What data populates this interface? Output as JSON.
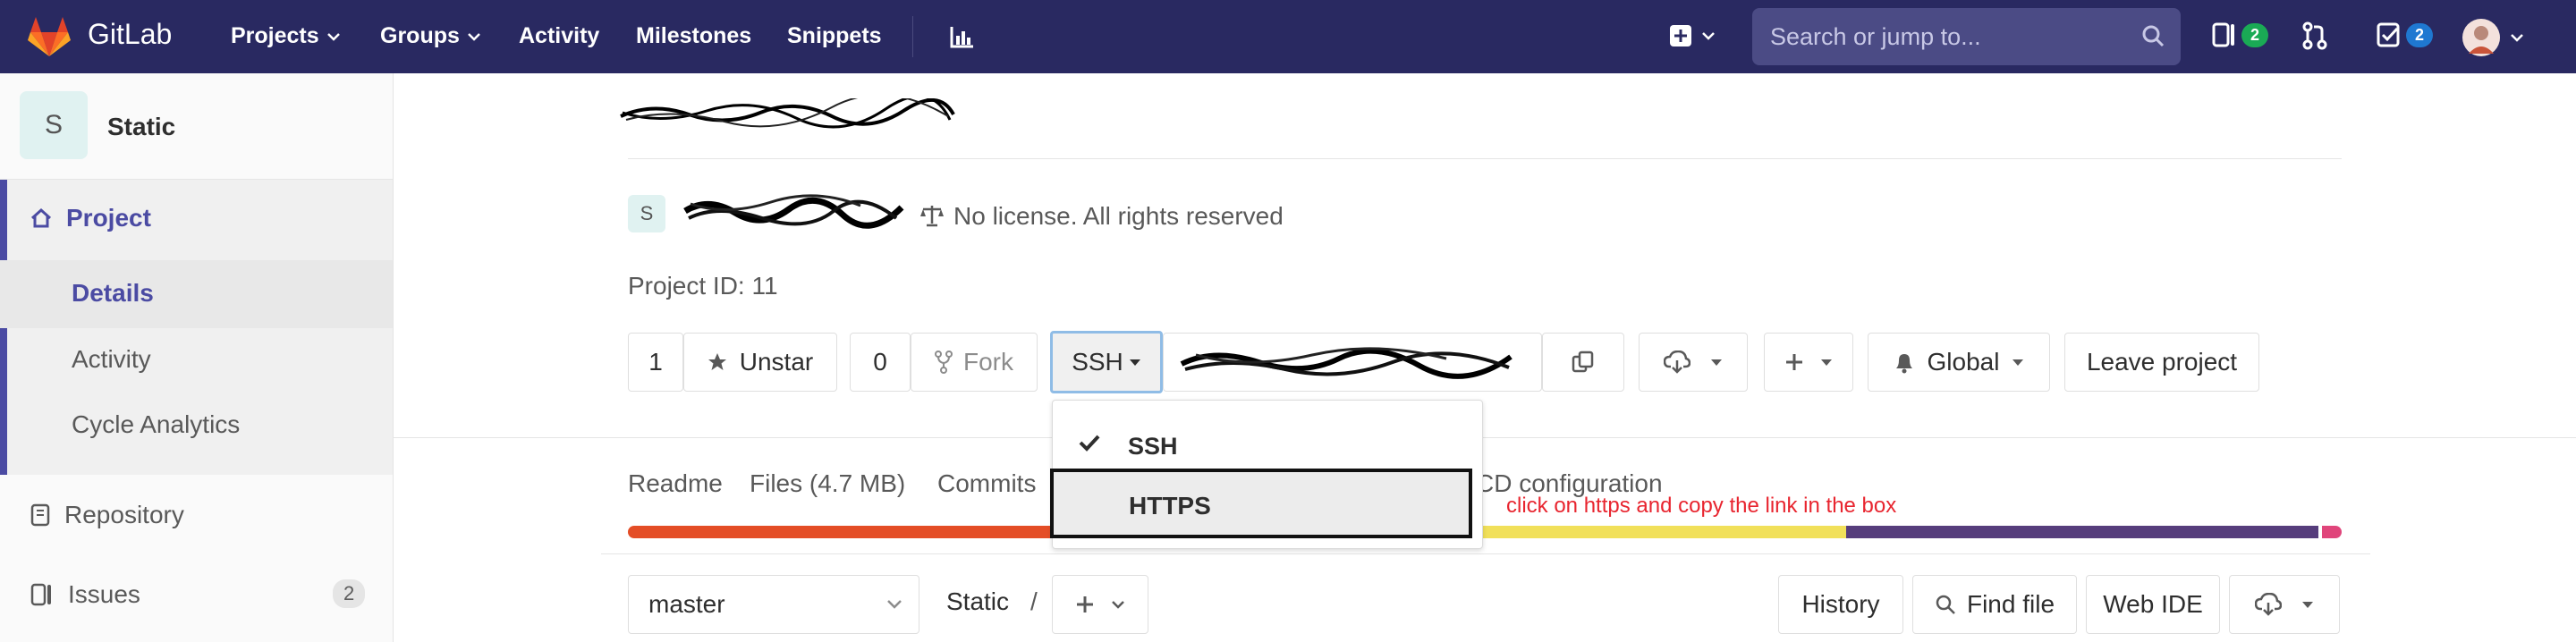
{
  "navbar": {
    "brand": "GitLab",
    "links": [
      "Projects",
      "Groups",
      "Activity",
      "Milestones",
      "Snippets"
    ],
    "search_placeholder": "Search or jump to...",
    "issues_count": "2",
    "todos_count": "2",
    "bg_color": "#292961"
  },
  "sidebar": {
    "avatar_letter": "S",
    "project_name": "Static",
    "project_label": "Project",
    "sub_items": [
      "Details",
      "Activity",
      "Cycle Analytics"
    ],
    "repository": "Repository",
    "issues": "Issues",
    "issues_count": "2"
  },
  "project": {
    "avatar_letter": "S",
    "license": "No license. All rights reserved",
    "project_id": "Project ID: 11"
  },
  "actions": {
    "star_count": "1",
    "unstar": "Unstar",
    "fork_count": "0",
    "fork": "Fork",
    "protocol": "SSH",
    "notification": "Global",
    "leave": "Leave project"
  },
  "dropdown": {
    "ssh": "SSH",
    "https": "HTTPS"
  },
  "annotation": "click on https and copy the link in the box",
  "tabs": {
    "readme": "Readme",
    "files": "Files (4.7 MB)",
    "commits": "Commits",
    "ci": "CD configuration"
  },
  "repo_bar": {
    "branch": "master",
    "path": "Static",
    "separator": "/",
    "history": "History",
    "find_file": "Find file",
    "web_ide": "Web IDE"
  }
}
